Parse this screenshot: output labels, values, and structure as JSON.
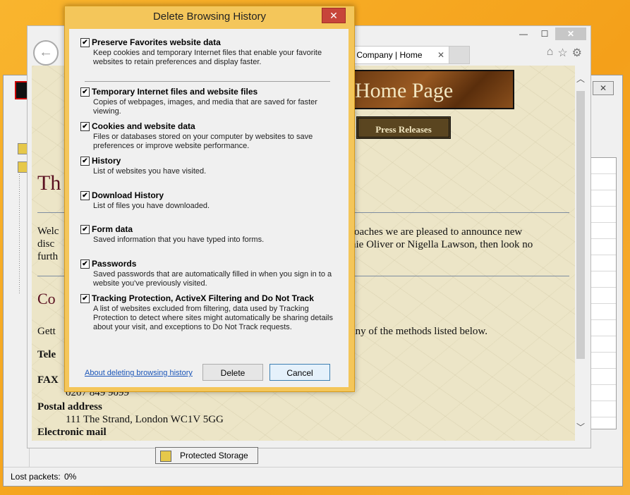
{
  "dialog": {
    "title": "Delete Browsing History",
    "close_glyph": "✕",
    "options": [
      {
        "label": "Preserve Favorites website data",
        "checked": true,
        "description": "Keep cookies and temporary Internet files that enable your favorite websites to retain preferences and display faster."
      },
      {
        "label": "Temporary Internet files and website files",
        "checked": true,
        "description": "Copies of webpages, images, and media that are saved for faster viewing."
      },
      {
        "label": "Cookies and website data",
        "checked": true,
        "description": "Files or databases stored on your computer by websites to save preferences or improve website performance."
      },
      {
        "label": "History",
        "checked": true,
        "description": "List of websites you have visited."
      },
      {
        "label": "Download History",
        "checked": true,
        "description": "List of files you have downloaded."
      },
      {
        "label": "Form data",
        "checked": true,
        "description": "Saved information that you have typed into forms."
      },
      {
        "label": "Passwords",
        "checked": true,
        "description": "Saved passwords that are automatically filled in when you sign in to a website you've previously visited."
      },
      {
        "label": "Tracking Protection, ActiveX Filtering and Do Not Track",
        "checked": true,
        "description": "A list of websites excluded from filtering, data used by Tracking Protection to detect where sites might automatically be sharing details about your visit, and exceptions to Do Not Track requests."
      }
    ],
    "about_link": "About deleting browsing history",
    "delete_label": "Delete",
    "cancel_label": "Cancel"
  },
  "browser": {
    "tab_label": "k Company | Home",
    "tab_close": "✕",
    "back_glyph": "←",
    "controls": {
      "minimize": "—",
      "maximize": "☐",
      "close": "✕"
    },
    "nav_icons": [
      "home-icon",
      "favorites-star-icon",
      "settings-gear-icon"
    ]
  },
  "page": {
    "banner": "Home Page",
    "press_button": "Press Releases",
    "heading_fragment": "Th",
    "para_left": "Welc disc furth",
    "para_right_line1": "roaches we are pleased to announce  new",
    "para_right_line2": "nie Oliver or Nigella Lawson, then look no",
    "contact_heading_fragment": "Co",
    "gett": "Gett",
    "methods_text": "any of the methods listed below.",
    "tele_label": "Tele",
    "fax_label": "FAX",
    "fax_number": "0207 849 9099",
    "postal_label": "Postal address",
    "address": "111 The Strand, London WC1V 5GG",
    "email_label": "Electronic mail"
  },
  "back_app": {
    "protected_storage": "Protected Storage",
    "status_label": "Lost packets:",
    "status_value": "0%",
    "close_glyph": "✕"
  }
}
